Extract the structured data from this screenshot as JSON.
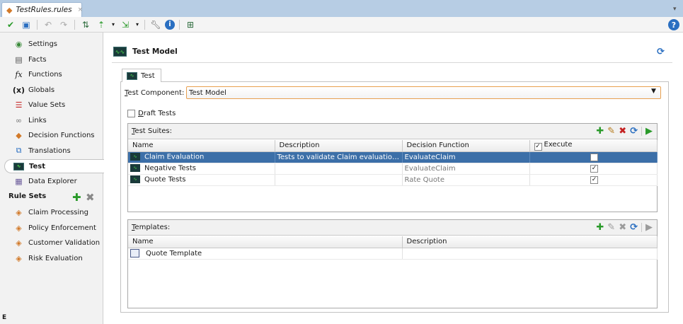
{
  "tab": {
    "title": "TestRules.rules",
    "close": "×"
  },
  "toolbar": {
    "icons": [
      "validate-icon",
      "save-icon",
      "undo-icon",
      "redo-icon",
      "compare-icon",
      "import-icon",
      "export-icon",
      "tools-icon",
      "info-icon",
      "tree-icon"
    ]
  },
  "help_label": "?",
  "sidebar": {
    "items": [
      {
        "label": "Settings",
        "icon": "settings-icon"
      },
      {
        "label": "Facts",
        "icon": "facts-icon"
      },
      {
        "label": "Functions",
        "icon": "functions-icon"
      },
      {
        "label": "Globals",
        "icon": "globals-icon"
      },
      {
        "label": "Value Sets",
        "icon": "valuesets-icon"
      },
      {
        "label": "Links",
        "icon": "links-icon"
      },
      {
        "label": "Decision Functions",
        "icon": "decision-functions-icon"
      },
      {
        "label": "Translations",
        "icon": "translations-icon"
      },
      {
        "label": "Test",
        "icon": "test-icon",
        "selected": true
      },
      {
        "label": "Data Explorer",
        "icon": "data-explorer-icon"
      }
    ],
    "rule_sets_label": "Rule Sets",
    "rule_sets": [
      "Claim Processing",
      "Policy Enforcement",
      "Customer Validation",
      "Risk Evaluation"
    ],
    "bottom_label": "E"
  },
  "page": {
    "title": "Test Model",
    "tab_label": "Test"
  },
  "test_component": {
    "label_u": "T",
    "label_rest": "est Component:",
    "value": "Test Model"
  },
  "draft": {
    "label_u": "D",
    "label_rest": "raft Tests",
    "checked": false
  },
  "suites": {
    "label_u": "T",
    "label_rest": "est Suites:",
    "columns": [
      "Name",
      "Description",
      "Decision Function",
      "Execute"
    ],
    "rows": [
      {
        "name": "Claim Evaluation",
        "description": "Tests to validate Claim evaluation R...",
        "function": "EvaluateClaim",
        "execute": true,
        "selected": true
      },
      {
        "name": "Negative Tests",
        "description": "",
        "function": "EvaluateClaim",
        "execute": true
      },
      {
        "name": "Quote Tests",
        "description": "",
        "function": "Rate Quote",
        "execute": true
      }
    ]
  },
  "templates": {
    "label_u": "T",
    "label_rest": "emplates:",
    "columns": [
      "Name",
      "Description"
    ],
    "rows": [
      {
        "name": "Quote Template",
        "description": ""
      }
    ]
  },
  "colors": {
    "accent": "#3c6fa8",
    "add": "#2a9a2a",
    "delete": "#c42020",
    "focus": "#e8a050"
  }
}
